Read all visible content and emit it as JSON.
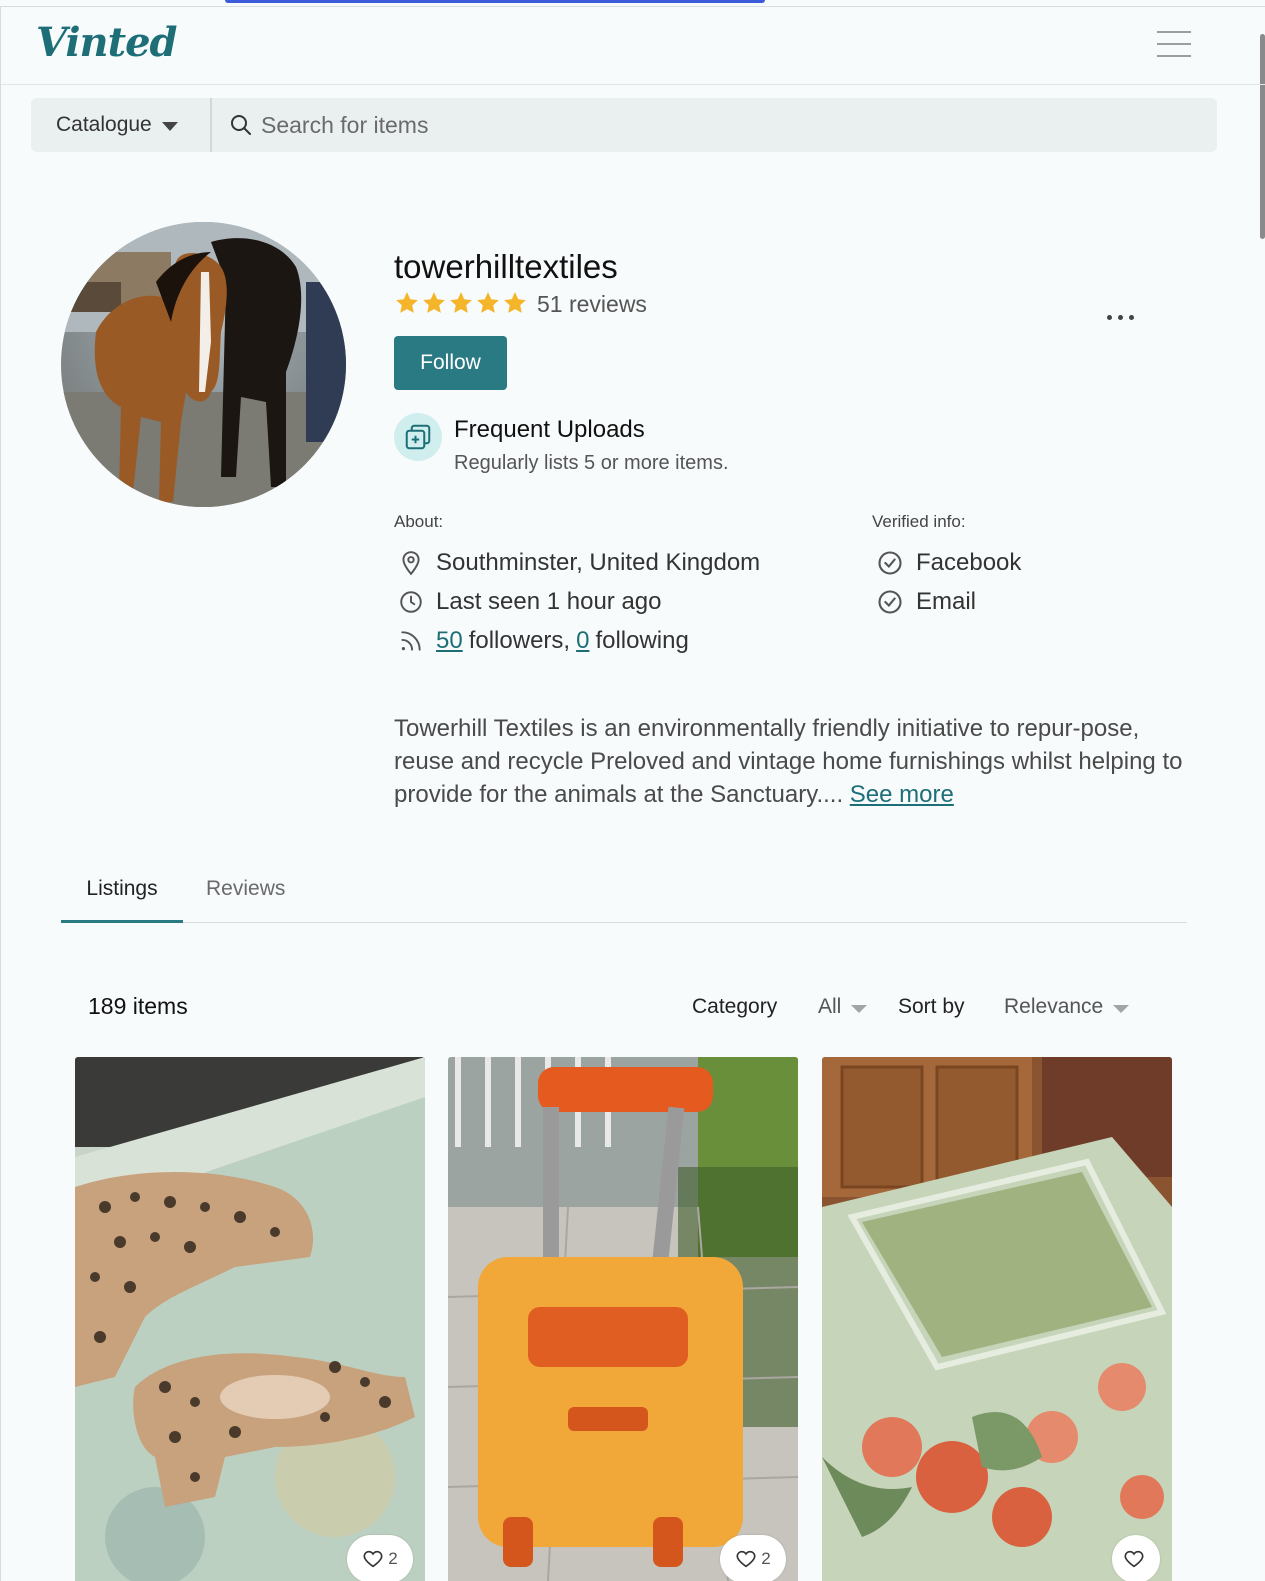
{
  "brand": {
    "logo_text": "Vinted",
    "accent_color": "#2a7a83"
  },
  "search": {
    "catalogue_label": "Catalogue",
    "placeholder": "Search for items"
  },
  "profile": {
    "username": "towerhilltextiles",
    "rating_stars": 5,
    "reviews_label": "51 reviews",
    "follow_label": "Follow",
    "badge": {
      "title": "Frequent Uploads",
      "description": "Regularly lists 5 or more items."
    },
    "about": {
      "label": "About:",
      "location": "Southminster, United Kingdom",
      "last_seen": "Last seen 1 hour ago",
      "followers_count": "50",
      "followers_text": "followers,",
      "following_count": "0",
      "following_text": "following"
    },
    "verified": {
      "label": "Verified info:",
      "items": [
        "Facebook",
        "Email"
      ]
    },
    "bio_text": "Towerhill Textiles is an environmentally friendly initiative to repur-pose, reuse and recycle Preloved and vintage home furnishings whilst helping to provide for the animals at the Sanctuary....",
    "see_more_label": "See more"
  },
  "tabs": [
    {
      "label": "Listings",
      "active": true
    },
    {
      "label": "Reviews",
      "active": false
    }
  ],
  "listings": {
    "count_label": "189 items",
    "category_label": "Category",
    "category_value": "All",
    "sort_label": "Sort by",
    "sort_value": "Relevance",
    "items": [
      {
        "favourites": "2",
        "icon": "heart-icon"
      },
      {
        "favourites": "2",
        "icon": "heart-icon"
      },
      {
        "favourites": "",
        "icon": "heart-icon"
      }
    ]
  }
}
